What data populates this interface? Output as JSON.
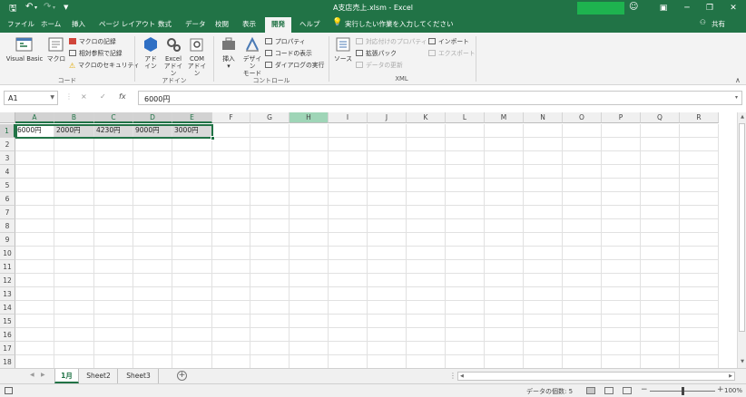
{
  "window": {
    "title": "A支店売上.xlsm  -  Excel"
  },
  "quick_access": {
    "save_icon": "save-icon",
    "undo_icon": "undo-icon",
    "redo_icon": "redo-icon",
    "customize_icon": "customize-icon"
  },
  "ribbon_tabs": [
    "ファイル",
    "ホーム",
    "挿入",
    "ページ レイアウト",
    "数式",
    "データ",
    "校閲",
    "表示",
    "開発",
    "ヘルプ"
  ],
  "active_tab": "開発",
  "tell_me": "実行したい作業を入力してください",
  "share": "共有",
  "ribbon": {
    "code": {
      "visual_basic": "Visual Basic",
      "macro": "マクロ",
      "record_macro": "マクロの記録",
      "relative_ref": "相対参照で記録",
      "macro_security": "マクロのセキュリティ",
      "group_label": "コード"
    },
    "addins": {
      "addin_line1": "アド",
      "addin_line2": "イン",
      "excel_addin_line1": "Excel",
      "excel_addin_line2": "アドイン",
      "com_addin_line1": "COM",
      "com_addin_line2": "アドイン",
      "group_label": "アドイン"
    },
    "controls": {
      "insert": "挿入",
      "design_mode_line1": "デザイン",
      "design_mode_line2": "モード",
      "properties": "プロパティ",
      "view_code": "コードの表示",
      "run_dialog": "ダイアログの実行",
      "group_label": "コントロール"
    },
    "xml": {
      "source": "ソース",
      "map_properties": "対応付けのプロパティ",
      "expansion_packs": "拡張パック",
      "refresh_data": "データの更新",
      "import": "インポート",
      "export": "エクスポート",
      "group_label": "XML"
    }
  },
  "formula_bar": {
    "name_box": "A1",
    "cancel_symbol": "×",
    "enter_symbol": "✓",
    "fx_symbol": "fx",
    "content": "6000円"
  },
  "columns": [
    "A",
    "B",
    "C",
    "D",
    "E",
    "F",
    "G",
    "H",
    "I",
    "J",
    "K",
    "L",
    "M",
    "N",
    "O",
    "P",
    "Q",
    "R"
  ],
  "rows": [
    "1",
    "2",
    "3",
    "4",
    "5",
    "6",
    "7",
    "8",
    "9",
    "10",
    "11",
    "12",
    "13",
    "14",
    "15",
    "16",
    "17",
    "18"
  ],
  "cells_row1": [
    "6000円",
    "2000円",
    "4230円",
    "9000円",
    "3000円"
  ],
  "sheets": [
    "1月",
    "Sheet2",
    "Sheet3"
  ],
  "active_sheet": "1月",
  "status": {
    "count": "データの個数: 5",
    "zoom_minus": "−",
    "zoom_plus": "+",
    "zoom": "100%"
  },
  "colors": {
    "excel_green": "#217346",
    "selected_header_bg": "#d2d2d2",
    "highlighted_column": "#9fd5b7"
  }
}
